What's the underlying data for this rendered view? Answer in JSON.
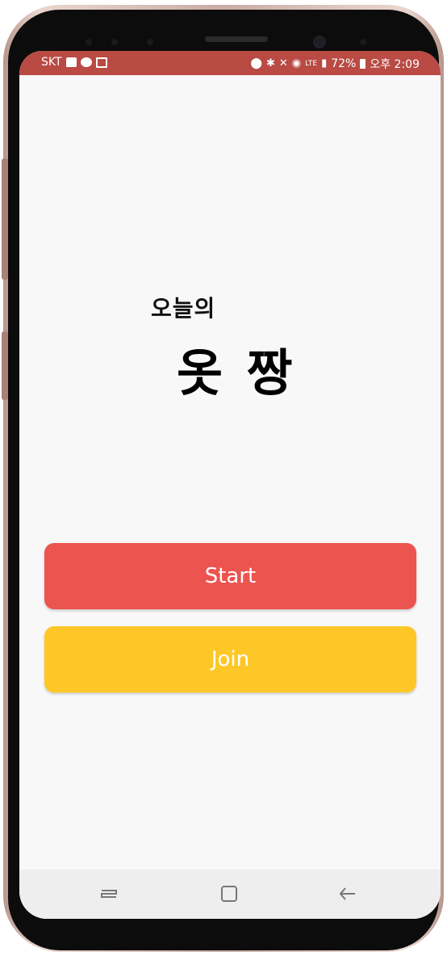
{
  "status_bar": {
    "carrier": "SKT",
    "network": "LTE",
    "battery": "72%",
    "time": "오후 2:09",
    "left_icons": [
      "message-icon",
      "talk-icon",
      "image-icon"
    ],
    "right_icons": [
      "location-icon",
      "bluetooth-icon",
      "mute-icon",
      "alarm-icon",
      "signal-icon",
      "battery-icon"
    ],
    "color": "#b94a44"
  },
  "main": {
    "subtitle": "오늘의",
    "title": "옷 짱"
  },
  "buttons": {
    "start_label": "Start",
    "join_label": "Join",
    "start_color": "#ec5450",
    "join_color": "#fdc827"
  },
  "nav_bar": {
    "icons": [
      "recent-apps-icon",
      "home-icon",
      "back-icon"
    ]
  }
}
